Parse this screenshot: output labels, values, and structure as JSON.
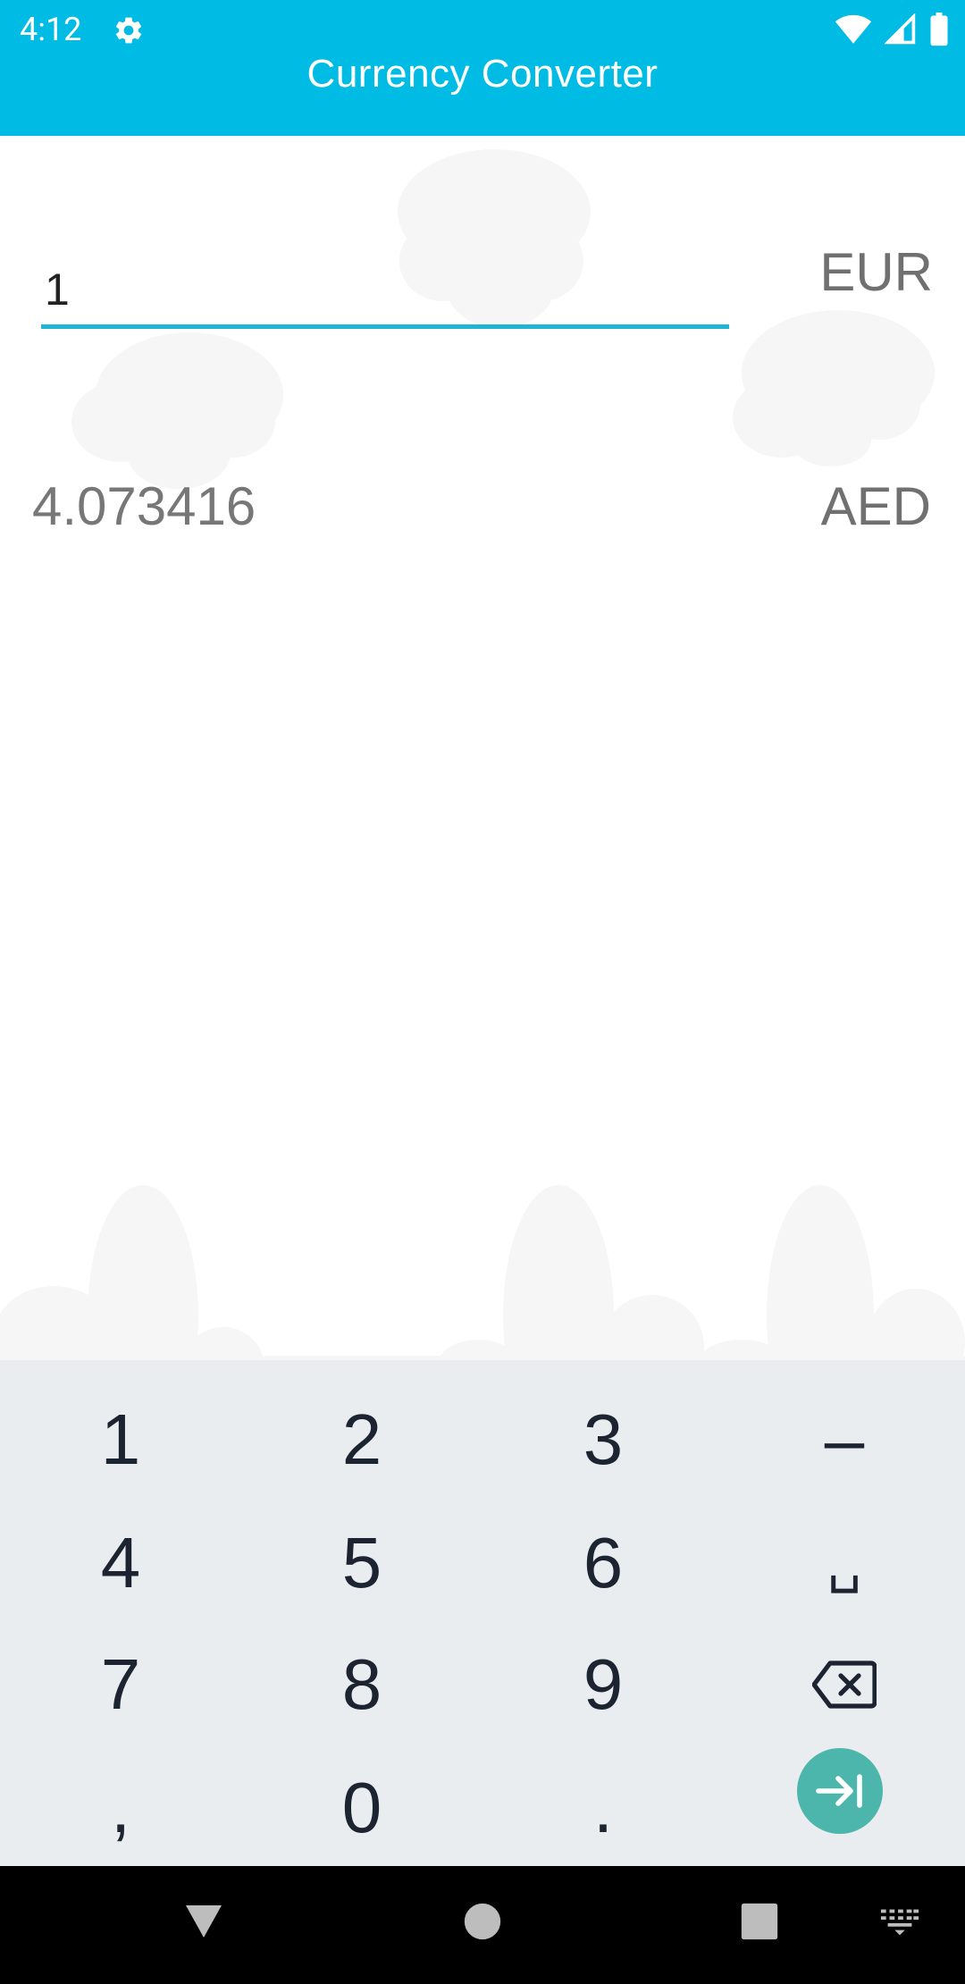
{
  "status_bar": {
    "time": "4:12",
    "icons": [
      "gear-icon",
      "wifi-icon",
      "cellular-signal-icon",
      "battery-icon"
    ]
  },
  "app_bar": {
    "title": "Currency Converter",
    "color": "#00bce4"
  },
  "converter": {
    "amount_value": "1",
    "from_currency": "EUR",
    "result_value": "4.073416",
    "to_currency": "AED",
    "accent_color": "#1fb3d4"
  },
  "keyboard": {
    "rows": [
      [
        "1",
        "2",
        "3",
        "–"
      ],
      [
        "4",
        "5",
        "6",
        "␣"
      ],
      [
        "7",
        "8",
        "9",
        "backspace-icon"
      ],
      [
        ",",
        "0",
        ".",
        "next-icon"
      ]
    ],
    "enter_color": "#4db6ac"
  },
  "navigation_bar": {
    "buttons": [
      "back-icon",
      "home-icon",
      "recents-icon",
      "keyboard-switch-icon"
    ]
  }
}
